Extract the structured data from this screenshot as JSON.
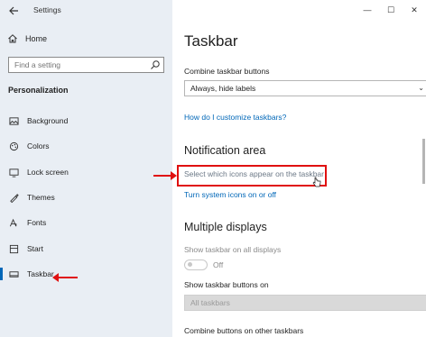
{
  "window": {
    "title": "Settings",
    "minimize": "—",
    "maximize": "☐",
    "close": "✕"
  },
  "sidebar": {
    "home_label": "Home",
    "search_placeholder": "Find a setting",
    "section_label": "Personalization",
    "items": [
      {
        "label": "Background",
        "icon": "picture-icon"
      },
      {
        "label": "Colors",
        "icon": "palette-icon"
      },
      {
        "label": "Lock screen",
        "icon": "lock-screen-icon"
      },
      {
        "label": "Themes",
        "icon": "brush-icon"
      },
      {
        "label": "Fonts",
        "icon": "font-icon"
      },
      {
        "label": "Start",
        "icon": "start-icon"
      },
      {
        "label": "Taskbar",
        "icon": "taskbar-icon",
        "selected": true
      }
    ]
  },
  "main": {
    "title": "Taskbar",
    "combine_label": "Combine taskbar buttons",
    "combine_value": "Always, hide labels",
    "customize_link": "How do I customize taskbars?",
    "notification_heading": "Notification area",
    "select_icons_link": "Select which icons appear on the taskbar",
    "system_icons_link": "Turn system icons on or off",
    "multiple_heading": "Multiple displays",
    "show_all_label": "Show taskbar on all displays",
    "toggle_state": "Off",
    "show_buttons_label": "Show taskbar buttons on",
    "show_buttons_value": "All taskbars",
    "combine_other_label": "Combine buttons on other taskbars"
  },
  "colors": {
    "accent": "#0067b8",
    "annotation": "#e01010",
    "sidebar_bg": "#e9eef4"
  }
}
